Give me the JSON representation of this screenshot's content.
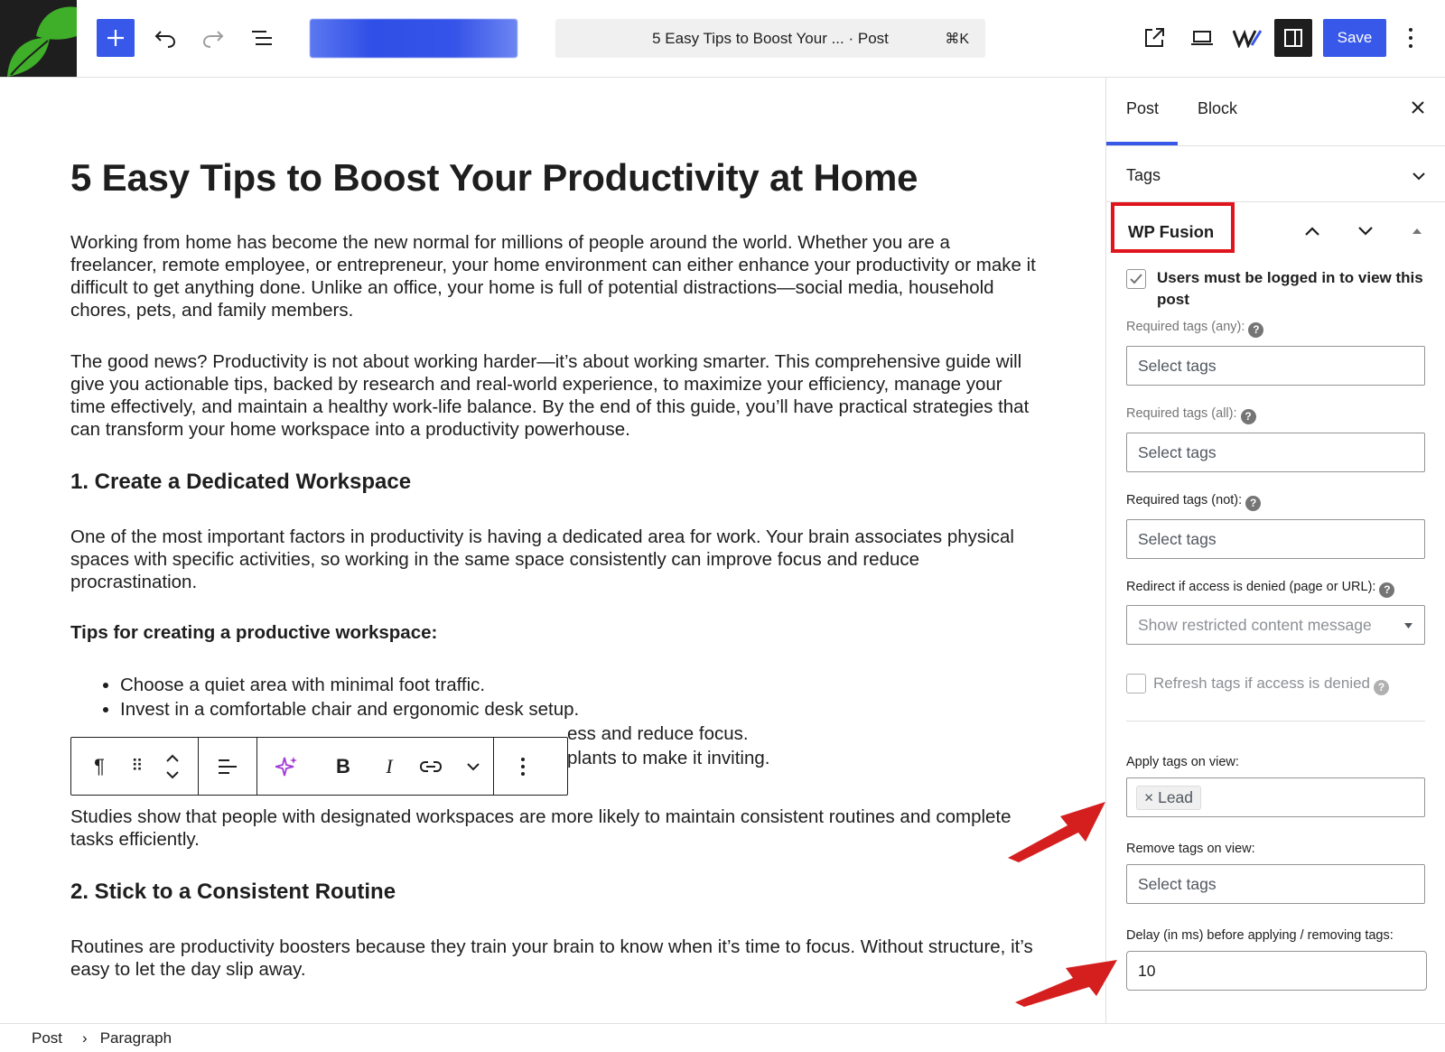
{
  "topbar": {
    "command_title": "5 Easy Tips to Boost Your ... · Post",
    "command_shortcut": "⌘K",
    "save_label": "Save"
  },
  "post": {
    "title": "5 Easy Tips to Boost Your Productivity at Home",
    "p1": "Working from home has become the new normal for millions of people around the world. Whether you are a freelancer, remote employee, or entrepreneur, your home environment can either enhance your productivity or make it difficult to get anything done. Unlike an office, your home is full of potential distractions—social media, household chores, pets, and family members.",
    "p2": "The good news? Productivity is not about working harder—it’s about working smarter. This comprehensive guide will give you actionable tips, backed by research and real-world experience, to maximize your efficiency, manage your time effectively, and maintain a healthy work-life balance. By the end of this guide, you’ll have practical strategies that can transform your home workspace into a productivity powerhouse.",
    "h_workspace": "1. Create a Dedicated Workspace",
    "p3": "One of the most important factors in productivity is having a dedicated area for work. Your brain associates physical spaces with specific activities, so working in the same space consistently can improve focus and reduce procrastination.",
    "tips_heading": "Tips for creating a productive workspace:",
    "tips": [
      "Choose a quiet area with minimal foot traffic.",
      "Invest in a comfortable chair and ergonomic desk setup.",
      "ess and reduce focus.",
      "plants to make it inviting."
    ],
    "p4": "Studies show that people with designated workspaces are more likely to maintain consistent routines and complete tasks efficiently.",
    "h_routine": "2. Stick to a Consistent Routine",
    "p5": "Routines are productivity boosters because they train your brain to know when it’s time to focus. Without structure, it’s easy to let the day slip away."
  },
  "sidebar": {
    "tab_post": "Post",
    "tab_block": "Block",
    "tags_panel": "Tags",
    "wpf_title": "WP Fusion",
    "logged_in_label": "Users must be logged in to view this post",
    "logged_in_checked": true,
    "req_any_label": "Required tags (any):",
    "req_all_label": "Required tags (all):",
    "req_not_label": "Required tags (not):",
    "redirect_label": "Redirect if access is denied (page or URL):",
    "redirect_value": "Show restricted content message",
    "refresh_label": "Refresh tags if access is denied",
    "apply_label": "Apply tags on view:",
    "apply_tag": "Lead",
    "remove_label": "Remove tags on view:",
    "delay_label": "Delay (in ms) before applying / removing tags:",
    "delay_value": "10",
    "select_placeholder": "Select tags"
  },
  "footer": {
    "crumb1": "Post",
    "separator": "›",
    "crumb2": "Paragraph"
  },
  "colors": {
    "accent": "#3858e9",
    "highlight": "#e0141c"
  }
}
